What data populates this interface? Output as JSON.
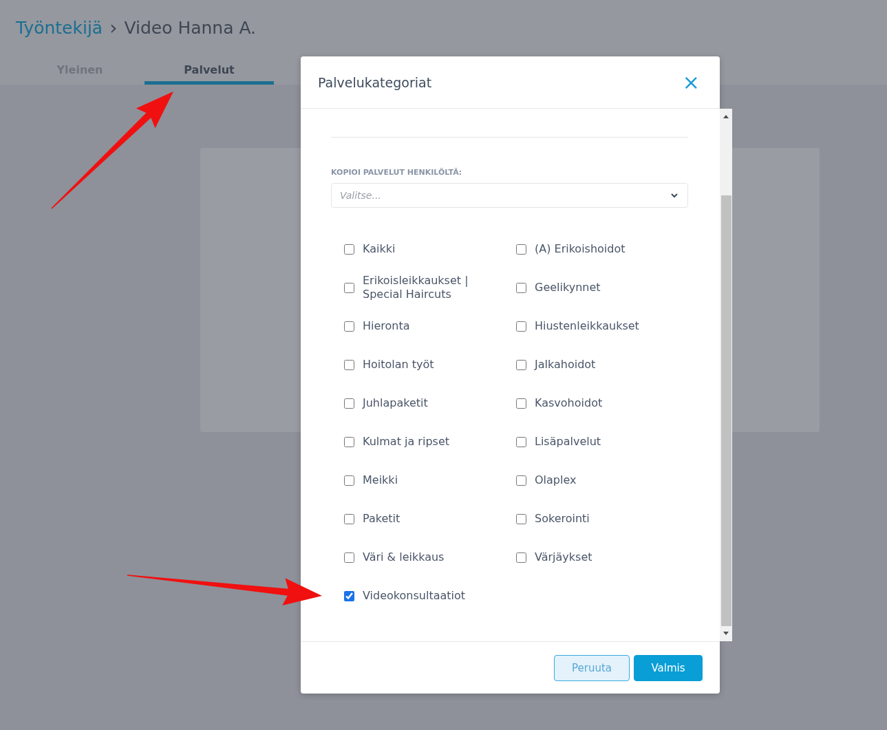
{
  "breadcrumb": {
    "parent": "Työntekijä",
    "separator": "›",
    "current": "Video Hanna A."
  },
  "tabs": [
    {
      "label": "Yleinen",
      "selected": false
    },
    {
      "label": "Palvelut",
      "selected": true
    }
  ],
  "modal": {
    "title": "Palvelukategoriat",
    "close": "×",
    "copy_label": "KOPIOI PALVELUT HENKILÖLTÄ:",
    "copy_select": {
      "placeholder": "Valitse..."
    },
    "categories": [
      {
        "label": "Kaikki",
        "checked": false
      },
      {
        "label": "(A) Erikoishoidot",
        "checked": false
      },
      {
        "label": "Erikoisleikkaukset | Special Haircuts",
        "checked": false
      },
      {
        "label": "Geelikynnet",
        "checked": false
      },
      {
        "label": "Hieronta",
        "checked": false
      },
      {
        "label": "Hiustenleikkaukset",
        "checked": false
      },
      {
        "label": "Hoitolan työt",
        "checked": false
      },
      {
        "label": "Jalkahoidot",
        "checked": false
      },
      {
        "label": "Juhlapaketit",
        "checked": false
      },
      {
        "label": "Kasvohoidot",
        "checked": false
      },
      {
        "label": "Kulmat ja ripset",
        "checked": false
      },
      {
        "label": "Lisäpalvelut",
        "checked": false
      },
      {
        "label": "Meikki",
        "checked": false
      },
      {
        "label": "Olaplex",
        "checked": false
      },
      {
        "label": "Paketit",
        "checked": false
      },
      {
        "label": "Sokerointi",
        "checked": false
      },
      {
        "label": "Väri & leikkaus",
        "checked": false
      },
      {
        "label": "Värjäykset",
        "checked": false
      },
      {
        "label": "Videokonsultaatiot",
        "checked": true
      }
    ],
    "buttons": [
      {
        "label": "Peruuta",
        "kind": "secondary"
      },
      {
        "label": "Valmis",
        "kind": "primary"
      }
    ]
  }
}
